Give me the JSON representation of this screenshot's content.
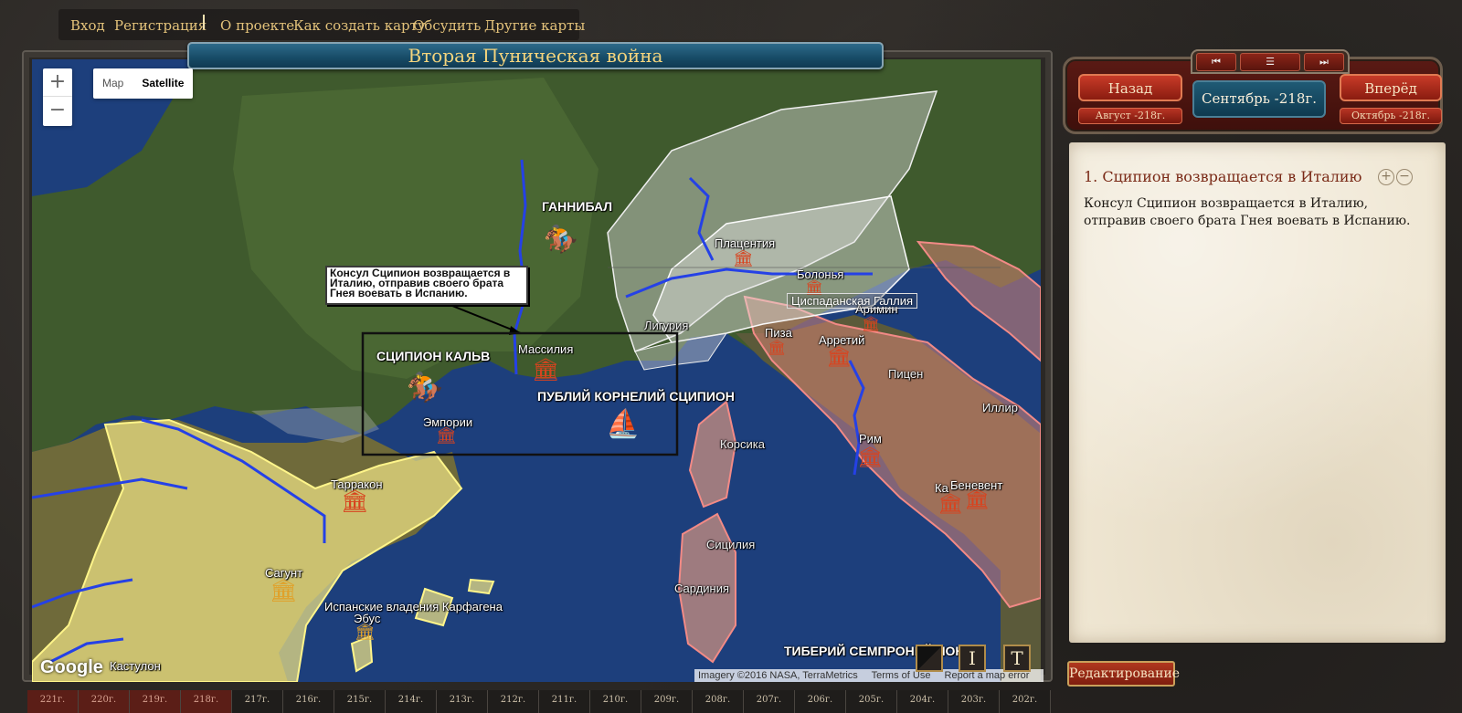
{
  "nav": {
    "login": "Вход",
    "register": "Регистрация",
    "about": "О проекте",
    "how_to": "Как создать карту",
    "discuss": "Обсудить",
    "other_maps": "Другие карты"
  },
  "map": {
    "title": "Вторая Пуническая война",
    "map_type_map": "Map",
    "map_type_satellite": "Satellite",
    "zoom_in": "+",
    "zoom_out": "−",
    "google_logo": "Google",
    "attribution": "Imagery ©2016 NASA, TerraMetrics",
    "terms": "Terms of Use",
    "report": "Report a map error",
    "callout_text": "Консул Сципион возвращается в Италию, отправив своего брата Гнея воевать в Испанию.",
    "labels": {
      "hannibal": "ГАННИБАЛ",
      "scipio_calvus": "СЦИПИОН КАЛЬВ",
      "publius": "ПУБЛИЙ КОРНЕЛИЙ СЦИПИОН",
      "tiberius": "ТИБЕРИЙ СЕМПРОНИЙ ЛОНГ",
      "massilia": "Массилия",
      "emporiae": "Эмпории",
      "tarraco": "Тарракон",
      "saguntum": "Сагунт",
      "spanish_carthage": "Испанские владения Карфагена",
      "ebus": "Эбус",
      "kastulon": "Кастулон",
      "placentia": "Плацентия",
      "bononia": "Болонья",
      "cispadane": "Циспаданская Галлия",
      "ariminum": "Аримин",
      "liguria": "Лигурия",
      "pisa": "Пиза",
      "arretium": "Арретий",
      "picenum": "Пицен",
      "illyria": "Иллир",
      "corsica": "Корсика",
      "rome": "Рим",
      "sicily": "Сицилия",
      "sardinia": "Сардиния",
      "capua": "Ка",
      "beneventum": "Беневент"
    },
    "tools": [
      "",
      "I",
      "T"
    ]
  },
  "timeline": [
    "221г.",
    "220г.",
    "219г.",
    "218г.",
    "217г.",
    "216г.",
    "215г.",
    "214г.",
    "213г.",
    "212г.",
    "211г.",
    "210г.",
    "209г.",
    "208г.",
    "207г.",
    "206г.",
    "205г.",
    "204г.",
    "203г.",
    "202г."
  ],
  "panel": {
    "back": "Назад",
    "forward": "Вперёд",
    "prev_date": "Август -218г.",
    "next_date": "Октябрь -218г.",
    "current_date": "Сентябрь -218г.",
    "page_first": "⏮",
    "page_list": "☰",
    "page_last": "⏭",
    "event_title": "1. Сципион возвращается в Италию",
    "event_text": "Консул Сципион возвращается в Италию, отправив своего брата Гнея воевать в Испанию.",
    "edit": "Редактирование",
    "zoom_plus": "+",
    "zoom_minus": "−"
  }
}
